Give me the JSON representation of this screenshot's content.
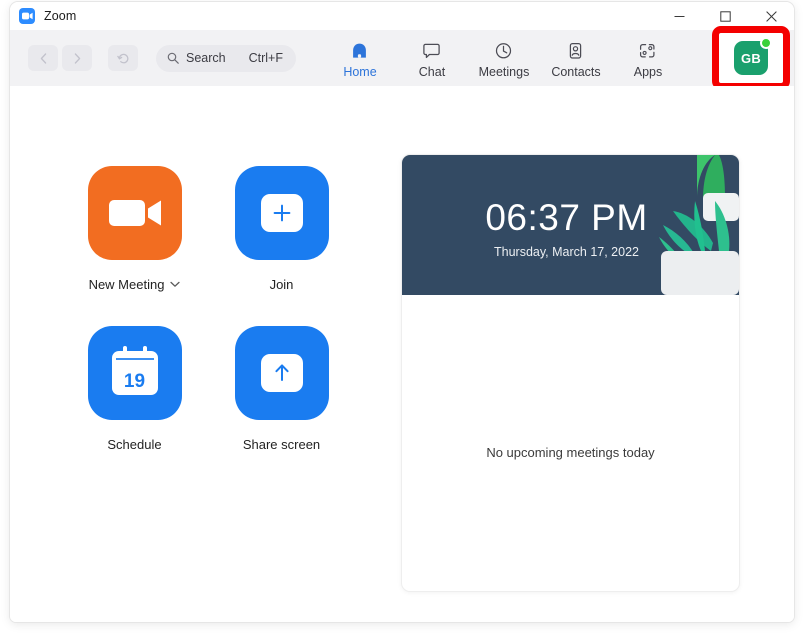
{
  "window": {
    "title": "Zoom",
    "logo_icon": "zoom-video-icon",
    "controls": {
      "minimize": "minimize-icon",
      "maximize": "maximize-icon",
      "close": "close-icon"
    }
  },
  "toolbar": {
    "back_icon": "chevron-left-icon",
    "forward_icon": "chevron-right-icon",
    "history_icon": "history-icon",
    "search": {
      "icon": "search-icon",
      "placeholder": "Search",
      "shortcut": "Ctrl+F"
    },
    "tabs": [
      {
        "label": "Home",
        "icon": "home-icon",
        "active": true
      },
      {
        "label": "Chat",
        "icon": "chat-bubble-icon",
        "active": false
      },
      {
        "label": "Meetings",
        "icon": "clock-icon",
        "active": false
      },
      {
        "label": "Contacts",
        "icon": "contact-card-icon",
        "active": false
      },
      {
        "label": "Apps",
        "icon": "apps-frame-icon",
        "active": false
      }
    ],
    "profile": {
      "initials": "GB",
      "avatar_color": "#1aa06d",
      "presence": "available",
      "presence_color": "#39d13a",
      "highlight_color": "#f40000",
      "highlighted": true
    },
    "settings_icon": "gear-icon"
  },
  "home": {
    "actions": [
      {
        "label": "New Meeting",
        "icon": "video-camera-icon",
        "color": "#f26d21",
        "has_dropdown": true
      },
      {
        "label": "Join",
        "icon": "plus-icon",
        "color": "#1a7cf0",
        "has_dropdown": false
      },
      {
        "label": "Schedule",
        "icon": "calendar-icon",
        "color": "#1a7cf0",
        "has_dropdown": false,
        "calendar_day": "19"
      },
      {
        "label": "Share screen",
        "icon": "upload-arrow-icon",
        "color": "#1a7cf0",
        "has_dropdown": false
      }
    ],
    "meetings_panel": {
      "clock": {
        "time": "06:37 PM",
        "date": "Thursday, March 17, 2022",
        "background_color": "#334a63"
      },
      "empty_message": "No upcoming meetings today"
    }
  }
}
